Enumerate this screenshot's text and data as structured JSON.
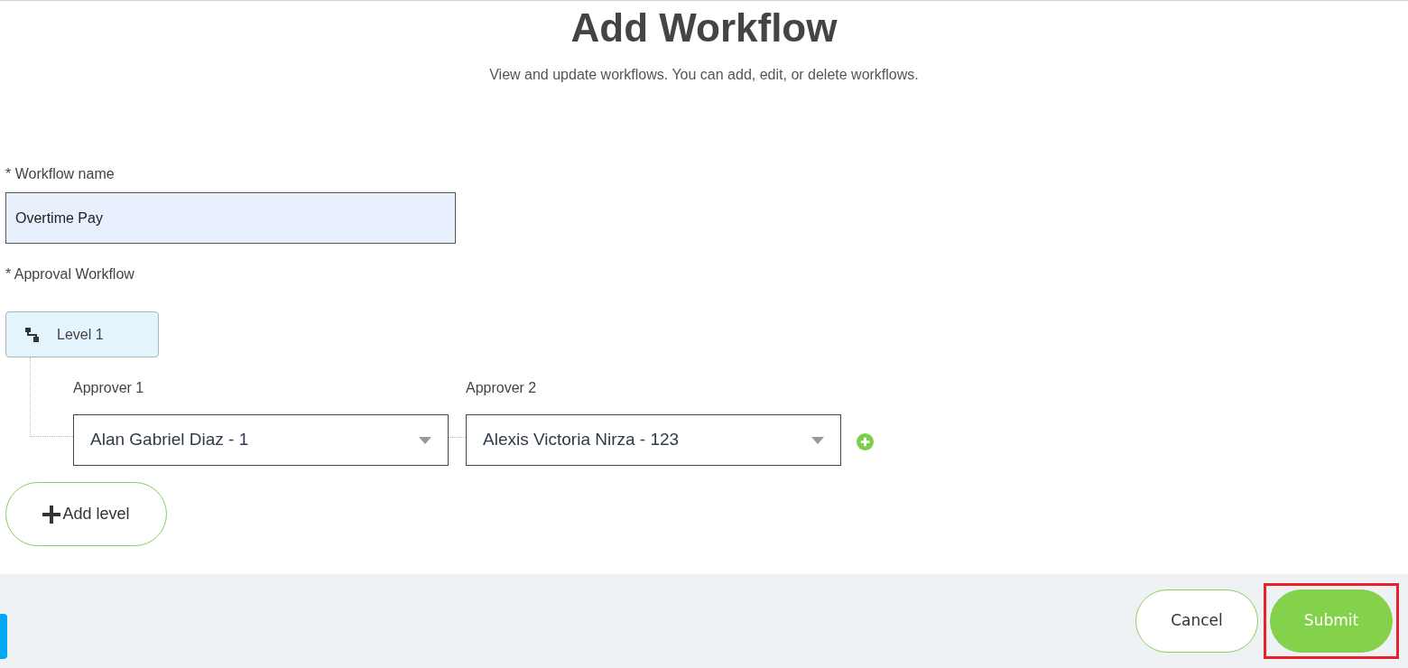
{
  "header": {
    "title": "Add Workflow",
    "subtitle": "View and update workflows. You can add, edit, or delete workflows."
  },
  "workflow_name": {
    "label": "* Workflow name",
    "value": "Overtime Pay"
  },
  "approval": {
    "label": "* Approval Workflow",
    "levels": [
      {
        "label": "Level 1",
        "approvers": [
          {
            "label": "Approver 1",
            "value": "Alan Gabriel Diaz - 1"
          },
          {
            "label": "Approver 2",
            "value": "Alexis Victoria Nirza - 123"
          }
        ]
      }
    ],
    "add_level": "Add level"
  },
  "footer": {
    "buttons": [
      {
        "label": "Cancel",
        "kind": "secondary"
      },
      {
        "label": "Submit",
        "kind": "primary",
        "highlighted": true
      }
    ]
  }
}
